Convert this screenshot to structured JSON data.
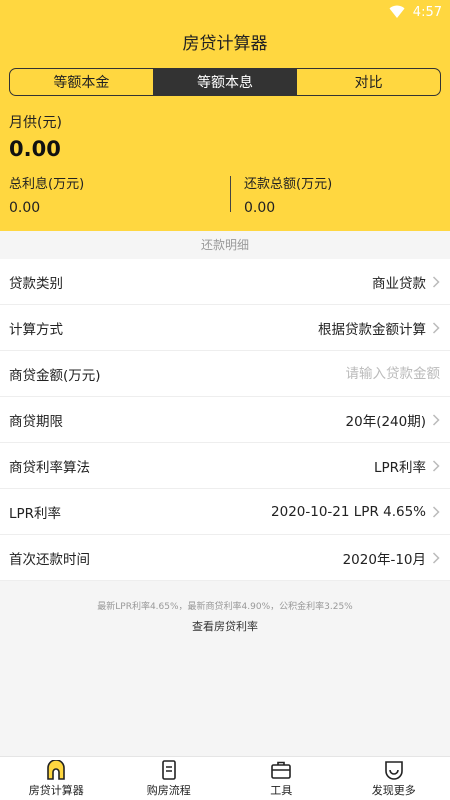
{
  "status": {
    "time": "4:57"
  },
  "header": {
    "title": "房贷计算器"
  },
  "segments": [
    {
      "label": "等额本金",
      "active": false
    },
    {
      "label": "等额本息",
      "active": true
    },
    {
      "label": "对比",
      "active": false
    }
  ],
  "summary": {
    "monthly_label": "月供(元)",
    "monthly_value": "0.00",
    "interest_label": "总利息(万元)",
    "interest_value": "0.00",
    "total_label": "还款总额(万元)",
    "total_value": "0.00"
  },
  "detail_link": "还款明细",
  "form": {
    "loan_type": {
      "label": "贷款类别",
      "value": "商业贷款"
    },
    "calc_method": {
      "label": "计算方式",
      "value": "根据贷款金额计算"
    },
    "amount": {
      "label": "商贷金额(万元)",
      "placeholder": "请输入贷款金额"
    },
    "term": {
      "label": "商贷期限",
      "value": "20年(240期)"
    },
    "rate_method": {
      "label": "商贷利率算法",
      "value": "LPR利率"
    },
    "lpr_rate": {
      "label": "LPR利率",
      "value": "2020-10-21 LPR 4.65%"
    },
    "first_payment": {
      "label": "首次还款时间",
      "value": "2020年-10月"
    }
  },
  "footnote": "最新LPR利率4.65%，最新商贷利率4.90%，公积金利率3.25%",
  "view_rate_link": "查看房贷利率",
  "tabbar": [
    {
      "label": "房贷计算器",
      "icon": "home-icon"
    },
    {
      "label": "购房流程",
      "icon": "document-icon"
    },
    {
      "label": "工具",
      "icon": "briefcase-icon"
    },
    {
      "label": "发现更多",
      "icon": "discover-icon"
    }
  ],
  "colors": {
    "accent": "#ffd740",
    "dark": "#333333"
  }
}
